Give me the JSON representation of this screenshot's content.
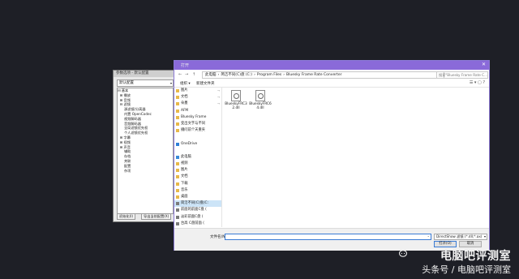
{
  "panel": {
    "title": "参数选项 - 默认配置",
    "profile": "默认配置",
    "tree": [
      "⊟ 基本",
      "  ⊞ 播放",
      "  ⊞ 音频",
      "  ⊟ 滤镜",
      "      源滤镜/分离器",
      "      内置 OpenCodec",
      "      视频解码器",
      "      音频解码器",
      "      全局滤镜优先权",
      "      个人滤镜优先权",
      "  ⊞ 字幕",
      "  ⊞ 视频",
      "  ⊞ 声音",
      "      辅助",
      "      存档",
      "      关联",
      "      配置",
      "      杂项"
    ],
    "reset_label": "初始化(I)",
    "export_label": "导出当前配置(X)"
  },
  "dialog": {
    "title": "打开",
    "close_glyph": "✕",
    "breadcrumb": [
      "此电脑",
      "›",
      "简洁不同(C)盘 (C:)",
      "›",
      "Program Files",
      "›",
      "Bluesky Frame Rate Converter"
    ],
    "search_placeholder": "搜索\"Bluesky Frame Rate C...",
    "organize_label": "组织 ▾",
    "new_folder_label": "新建文件夹",
    "nav_items": [
      {
        "label": "图片",
        "icon": "folder-icon",
        "pin": true
      },
      {
        "label": "文档",
        "icon": "folder-icon",
        "pin": true
      },
      {
        "label": "朵墨",
        "icon": "folder-icon",
        "pin": true
      },
      {
        "label": "AFM",
        "icon": "folder-icon",
        "pin": false
      },
      {
        "label": "Bluesky Frame",
        "icon": "folder-icon",
        "pin": false
      },
      {
        "label": "变出文字与不同",
        "icon": "folder-icon",
        "pin": false
      },
      {
        "label": "播问前个天重夹",
        "icon": "folder-icon",
        "pin": false
      },
      {
        "label": "",
        "icon": "",
        "pin": false
      },
      {
        "label": "OneDrive",
        "icon": "cloud-icon",
        "pin": false
      },
      {
        "label": "",
        "icon": "",
        "pin": false
      },
      {
        "label": "此电脑",
        "icon": "computer-icon",
        "pin": false
      },
      {
        "label": "视频",
        "icon": "folder-icon",
        "pin": false
      },
      {
        "label": "图片",
        "icon": "folder-icon",
        "pin": false
      },
      {
        "label": "文档",
        "icon": "folder-icon",
        "pin": false
      },
      {
        "label": "下载",
        "icon": "folder-icon",
        "pin": false
      },
      {
        "label": "音乐",
        "icon": "folder-icon",
        "pin": false
      },
      {
        "label": "桌面",
        "icon": "folder-icon",
        "pin": false
      },
      {
        "label": "简洁不同(C)盘(C:",
        "icon": "drive-icon",
        "pin": false,
        "selected": true
      },
      {
        "label": "前面的前面C盘 (",
        "icon": "drive-icon",
        "pin": false
      },
      {
        "label": "淡彩前面C盘 (",
        "icon": "drive-icon",
        "pin": false
      },
      {
        "label": "台高 C盘前面 (",
        "icon": "drive-icon",
        "pin": false
      },
      {
        "label": "热面C盘前时间 (",
        "icon": "drive-icon",
        "pin": false
      },
      {
        "label": "热恩C盘前时(C:",
        "icon": "drive-icon",
        "pin": false
      },
      {
        "label": "本了空灯C盘前 (",
        "icon": "drive-icon",
        "pin": false
      }
    ],
    "files": [
      {
        "name": "BlueskyFRC32.dll"
      },
      {
        "name": "BlueskyFRC64.dll"
      }
    ],
    "filename_label": "文件名(N):",
    "filename_value": "",
    "filetype_value": "DirectShow 滤镜 (*.dll;*.ax)",
    "open_label": "打开(O)",
    "cancel_label": "取消"
  },
  "watermark": {
    "line1": "电脑吧评测室",
    "line2": "头条号 / 电脑吧评测室"
  }
}
